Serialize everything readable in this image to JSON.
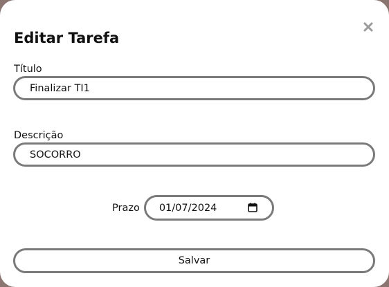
{
  "modal": {
    "title": "Editar Tarefa",
    "close_icon": "close-icon"
  },
  "form": {
    "titulo": {
      "label": "Título",
      "value": "Finalizar TI1"
    },
    "descricao": {
      "label": "Descrição",
      "value": "SOCORRO"
    },
    "prazo": {
      "label": "Prazo",
      "value": "01/07/2024",
      "icon": "calendar-icon"
    },
    "save_label": "Salvar"
  },
  "colors": {
    "backdrop": "#8a7570",
    "modal_bg": "#ffffff",
    "field_border": "#7a7a7a",
    "close_icon": "#9a9a9a",
    "text": "#111111"
  }
}
